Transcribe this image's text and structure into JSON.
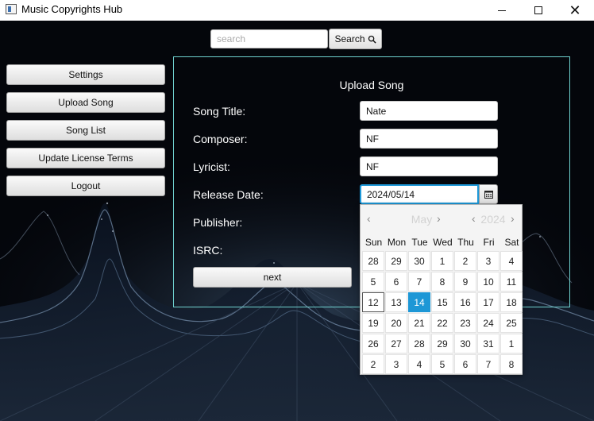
{
  "window": {
    "title": "Music Copyrights Hub"
  },
  "search": {
    "placeholder": "search",
    "button_label": "Search",
    "icon": "magnifier-icon"
  },
  "sidebar": {
    "items": [
      {
        "label": "Settings"
      },
      {
        "label": "Upload Song"
      },
      {
        "label": "Song List"
      },
      {
        "label": "Update License Terms"
      },
      {
        "label": "Logout"
      }
    ]
  },
  "form": {
    "title": "Upload Song",
    "fields": {
      "song_title": {
        "label": "Song Title:",
        "value": "Nate"
      },
      "composer": {
        "label": "Composer:",
        "value": "NF"
      },
      "lyricist": {
        "label": "Lyricist:",
        "value": "NF"
      },
      "release_date": {
        "label": "Release Date:",
        "value": "2024/05/14"
      },
      "publisher": {
        "label": "Publisher:"
      },
      "isrc": {
        "label": "ISRC:"
      }
    },
    "next_label": "next",
    "accent_color": "#6fd1cf"
  },
  "date_picker": {
    "month": "May",
    "year": "2024",
    "weekdays": [
      "Sun",
      "Mon",
      "Tue",
      "Wed",
      "Thu",
      "Fri",
      "Sat"
    ],
    "weeks": [
      [
        "28",
        "29",
        "30",
        "1",
        "2",
        "3",
        "4"
      ],
      [
        "5",
        "6",
        "7",
        "8",
        "9",
        "10",
        "11"
      ],
      [
        "12",
        "13",
        "14",
        "15",
        "16",
        "17",
        "18"
      ],
      [
        "19",
        "20",
        "21",
        "22",
        "23",
        "24",
        "25"
      ],
      [
        "26",
        "27",
        "28",
        "29",
        "30",
        "31",
        "1"
      ],
      [
        "2",
        "3",
        "4",
        "5",
        "6",
        "7",
        "8"
      ]
    ],
    "selected_day": "14",
    "today_day": "12",
    "selected_color": "#1d97d6"
  }
}
